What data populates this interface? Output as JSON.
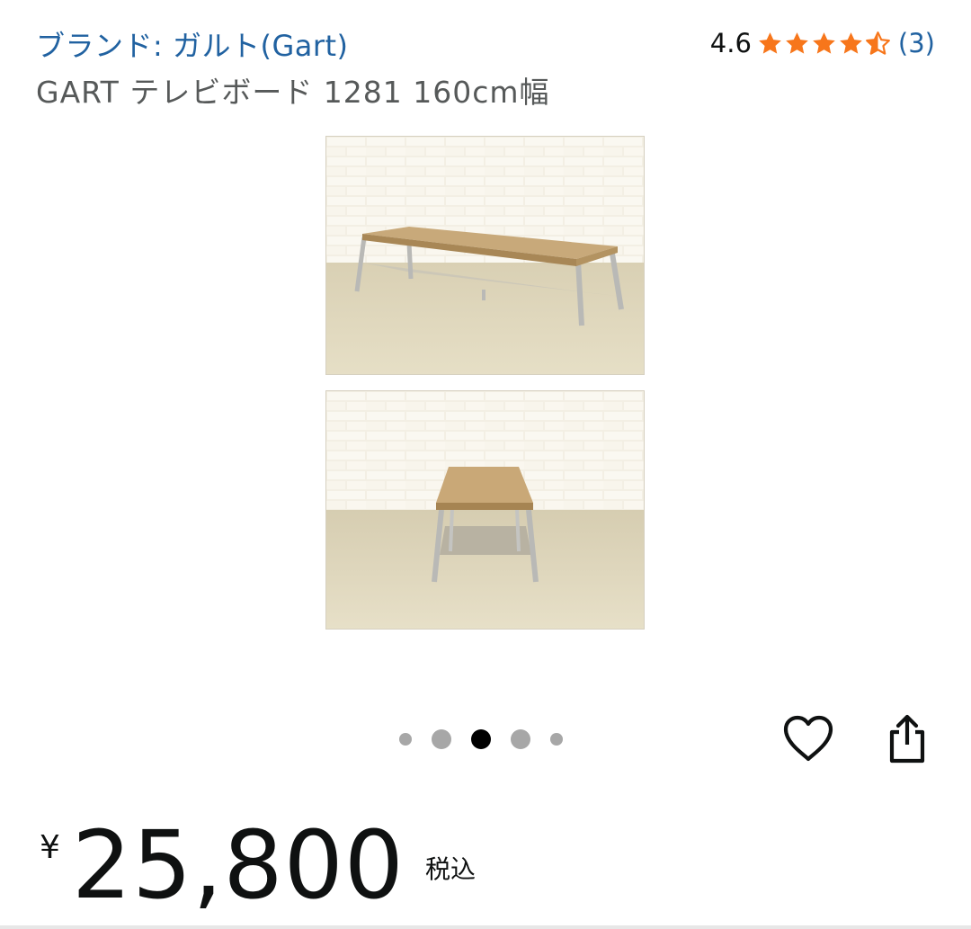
{
  "brand": {
    "link_text": "ブランド: ガルト(Gart)"
  },
  "rating": {
    "value": "4.6",
    "stars": 4.5,
    "count": "(3)",
    "star_color": "#f7761b"
  },
  "product": {
    "title": "GART テレビボード 1281 160cm幅"
  },
  "gallery": {
    "images": [
      {
        "name": "product-photo-perspective",
        "icon": "tv-board-angled-view"
      },
      {
        "name": "product-photo-side",
        "icon": "tv-board-side-view"
      }
    ],
    "dot_count": 5,
    "active_dot_index": 2
  },
  "actions": {
    "wishlist_icon": "heart-icon",
    "share_icon": "share-icon"
  },
  "price": {
    "currency": "¥",
    "amount": "25,800",
    "tax_label": "税込"
  },
  "colors": {
    "link": "#2162a1",
    "text": "#0f1111",
    "subtext": "#565959",
    "star": "#f7761b"
  }
}
